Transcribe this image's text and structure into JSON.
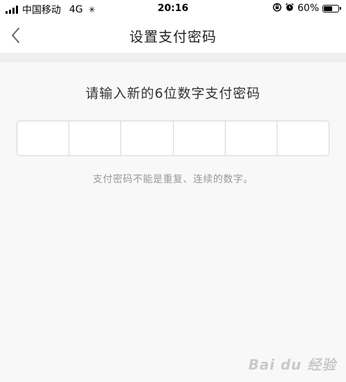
{
  "status_bar": {
    "carrier": "中国移动",
    "network": "4G",
    "time": "20:16",
    "battery_percent": "60%",
    "battery_level": 0.6,
    "icons": [
      "signal-icon",
      "loading-spinner-icon",
      "rotation-lock-icon",
      "alarm-icon",
      "battery-icon"
    ]
  },
  "nav": {
    "title": "设置支付密码",
    "back_icon": "chevron-left-icon"
  },
  "main": {
    "prompt": "请输入新的6位数字支付密码",
    "pin_digits": [
      "",
      "",
      "",
      "",
      "",
      ""
    ],
    "hint": "支付密码不能是重复、连续的数字。"
  },
  "watermark": {
    "text": "Bai du 经验"
  },
  "colors": {
    "background": "#f8f8f8",
    "bar_background": "#ffffff",
    "border": "#d6d6d6",
    "hint_text": "#999999"
  }
}
